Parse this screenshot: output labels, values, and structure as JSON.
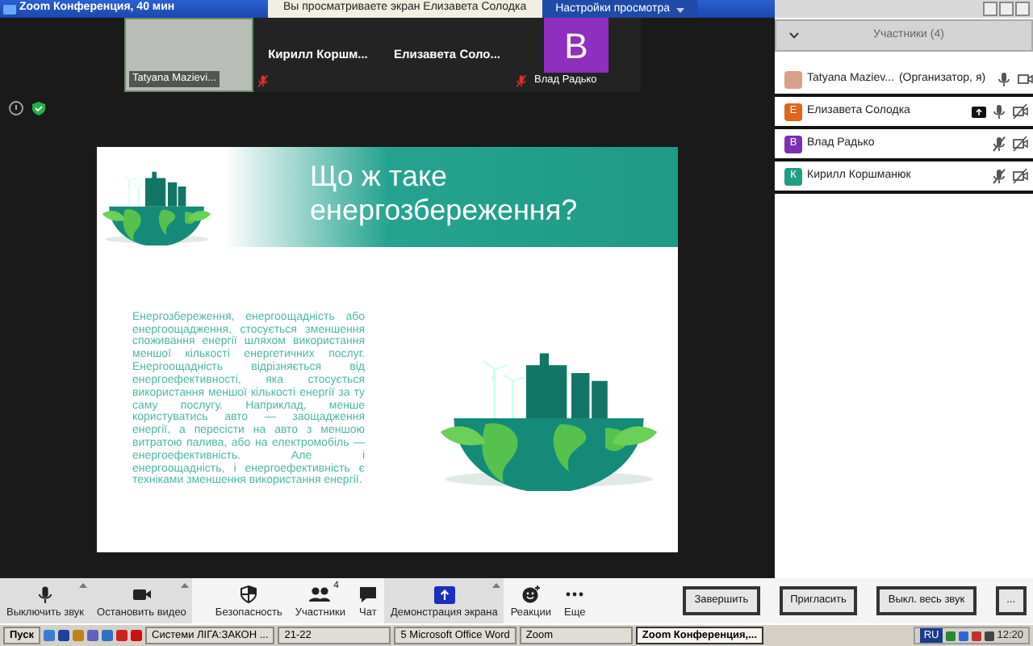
{
  "window": {
    "title": "Zoom Конференция, 40 мин"
  },
  "share_notice": {
    "text": "Вы просматриваете экран Елизавета Солодка",
    "button": "Настройки просмотра"
  },
  "video_tiles": [
    {
      "kind": "photo",
      "name": "Tatyana Mazievi...",
      "muted": false
    },
    {
      "kind": "name",
      "name": "Кирилл Коршм...",
      "muted": true
    },
    {
      "kind": "name",
      "name": "Елизавета Соло...",
      "muted": false
    },
    {
      "kind": "avatar",
      "initial": "B",
      "name": "Влад Радько",
      "muted": true,
      "color": "#8e2fc0"
    }
  ],
  "slide": {
    "title": "Що ж таке енергозбереження?",
    "body": "Енергозбереження, енергоощадність або енергоощадження, стосується зменшення споживання енергії шляхом використання меншої кількості енергетичних послуг. Енергоощадність відрізняється від енергоефективності, яка стосується використання меншої кількості енергії за ту саму послугу. Наприклад, менше користуватись авто — заощадження енергії, а пересісти на авто з меншою витратою палива, або на електромобіль — енергоефективність. Але і енергоощадність, і енергоефективність є техніками зменшення використання енергії."
  },
  "participants_panel": {
    "title": "Участники (4)",
    "participants": [
      {
        "name": "Tatyana Maziev...",
        "role": "(Организатор, я)",
        "sharing": false,
        "mic_muted": false,
        "video_on": true
      },
      {
        "name": "Елизавета Солодка",
        "initial": "Е",
        "color": "#e0661b",
        "sharing": true,
        "mic_muted": false,
        "video_on": false
      },
      {
        "name": "Влад Радько",
        "initial": "В",
        "color": "#7b2fb5",
        "sharing": false,
        "mic_muted": true,
        "video_on": false
      },
      {
        "name": "Кирилл Коршманюк",
        "initial": "К",
        "color": "#1e9e83",
        "sharing": false,
        "mic_muted": true,
        "video_on": false
      }
    ]
  },
  "toolbar": [
    {
      "kind": "mic",
      "label": "Выключить звук",
      "caret": true,
      "highlighted": true
    },
    {
      "kind": "video",
      "label": "Остановить видео",
      "caret": true,
      "highlighted": true
    },
    {
      "kind": "security",
      "label": "Безопасность",
      "caret": false,
      "highlighted": false
    },
    {
      "kind": "participants",
      "label": "Участники",
      "badge": "4",
      "caret": false,
      "highlighted": false
    },
    {
      "kind": "chat",
      "label": "Чат",
      "caret": false,
      "highlighted": false
    },
    {
      "kind": "share",
      "label": "Демонстрация экрана",
      "caret": true,
      "highlighted": true
    },
    {
      "kind": "reactions",
      "label": "Реакции",
      "caret": false,
      "highlighted": false
    },
    {
      "kind": "more",
      "label": "Еще",
      "caret": false,
      "highlighted": false
    }
  ],
  "end_button": "Завершить",
  "panel_buttons": [
    "Пригласить",
    "Выкл. весь звук",
    "..."
  ],
  "taskbar": {
    "start": "Пуск",
    "tasks": [
      {
        "label": "Системи ЛІГА:ЗАКОН ...",
        "selected": false
      },
      {
        "label": "21-22",
        "selected": false
      },
      {
        "label": "5 Microsoft Office Word",
        "selected": false
      },
      {
        "label": "Zoom",
        "selected": false
      },
      {
        "label": "Zoom Конференция,...",
        "selected": true
      }
    ],
    "language": "RU",
    "clock": "12:20"
  }
}
